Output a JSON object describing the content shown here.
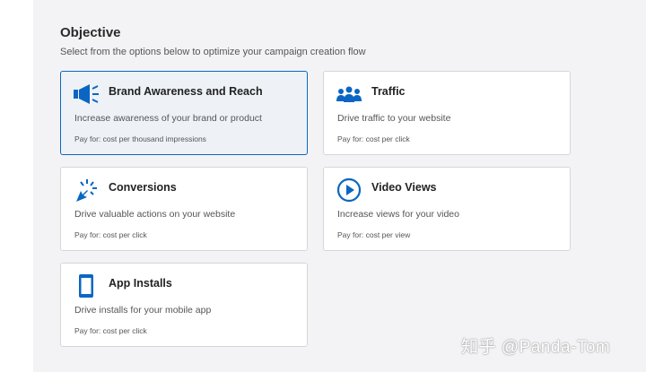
{
  "objective": {
    "heading": "Objective",
    "subheading": "Select from the options below to optimize your campaign creation flow"
  },
  "cards": [
    {
      "title": "Brand Awareness and Reach",
      "description": "Increase awareness of your brand or product",
      "pay": "Pay for: cost per thousand impressions",
      "icon": "megaphone-icon",
      "selected": true
    },
    {
      "title": "Traffic",
      "description": "Drive traffic to your website",
      "pay": "Pay for: cost per click",
      "icon": "people-icon",
      "selected": false
    },
    {
      "title": "Conversions",
      "description": "Drive valuable actions on your website",
      "pay": "Pay for: cost per click",
      "icon": "cursor-click-icon",
      "selected": false
    },
    {
      "title": "Video Views",
      "description": "Increase views for your video",
      "pay": "Pay for: cost per view",
      "icon": "play-circle-icon",
      "selected": false
    },
    {
      "title": "App Installs",
      "description": "Drive installs for your mobile app",
      "pay": "Pay for: cost per click",
      "icon": "mobile-phone-icon",
      "selected": false
    }
  ],
  "colors": {
    "accent": "#0a66c2",
    "panel_bg": "#f3f3f5",
    "card_border": "#d6d6d6"
  },
  "watermark": "知乎 @Panda-Tom"
}
